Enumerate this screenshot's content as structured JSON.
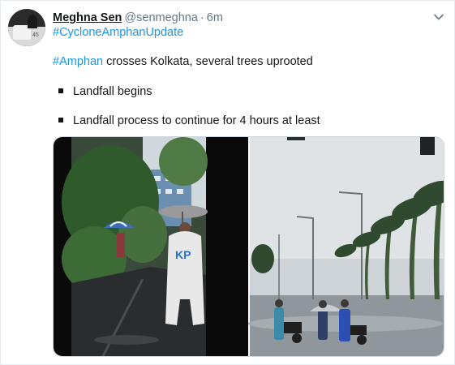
{
  "tweet": {
    "author_name": "Meghna Sen",
    "author_handle": "@senmeghna",
    "separator": "·",
    "time": "6m",
    "hashtag_line": "#CycloneAmphanUpdate",
    "line1_hashtag": "#Amphan",
    "line1_text": " crosses Kolkata, several trees uprooted",
    "bullets": [
      "Landfall begins",
      "Landfall process to continue for 4 hours at least"
    ],
    "media": {
      "left_photo_vest_text": "KP"
    }
  },
  "colors": {
    "link": "#1b95e0",
    "text": "#14171a",
    "muted": "#657786"
  },
  "icons": {
    "caret": "chevron-down-icon",
    "bullet": "square-bullet-icon"
  }
}
